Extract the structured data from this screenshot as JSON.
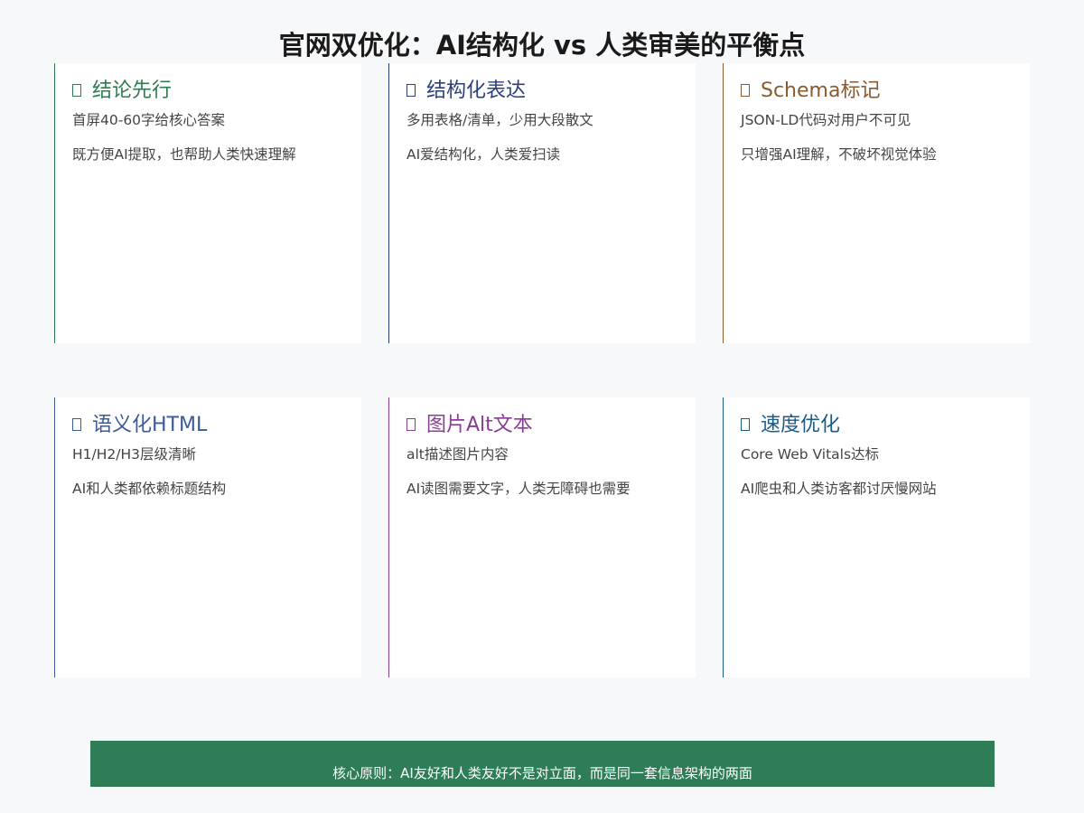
{
  "title": "官网双优化：AI结构化 vs 人类审美的平衡点",
  "cards": [
    {
      "title": "结论先行",
      "icon": "card-icon",
      "color": "#2e7d52",
      "lines": [
        "首屏40-60字给核心答案",
        "既方便AI提取，也帮助人类快速理解"
      ]
    },
    {
      "title": "结构化表达",
      "icon": "card-icon",
      "color": "#2b3f7a",
      "lines": [
        "多用表格/清单，少用大段散文",
        "AI爱结构化，人类爱扫读"
      ]
    },
    {
      "title": "Schema标记",
      "icon": "card-icon",
      "color": "#8a5a30",
      "lines": [
        "JSON-LD代码对用户不可见",
        "只增强AI理解，不破坏视觉体验"
      ]
    },
    {
      "title": "语义化HTML",
      "icon": "card-icon",
      "color": "#3b5a9a",
      "lines": [
        "H1/H2/H3层级清晰",
        "AI和人类都依赖标题结构"
      ]
    },
    {
      "title": "图片Alt文本",
      "icon": "card-icon",
      "color": "#8a3d96",
      "lines": [
        "alt描述图片内容",
        "AI读图需要文字，人类无障碍也需要"
      ]
    },
    {
      "title": "速度优化",
      "icon": "card-icon",
      "color": "#1a5b8a",
      "lines": [
        "Core Web Vitals达标",
        "AI爬虫和人类访客都讨厌慢网站"
      ]
    }
  ],
  "footer": {
    "text": "核心原则：AI友好和人类友好不是对立面，而是同一套信息架构的两面",
    "color": "#2e7d57"
  }
}
